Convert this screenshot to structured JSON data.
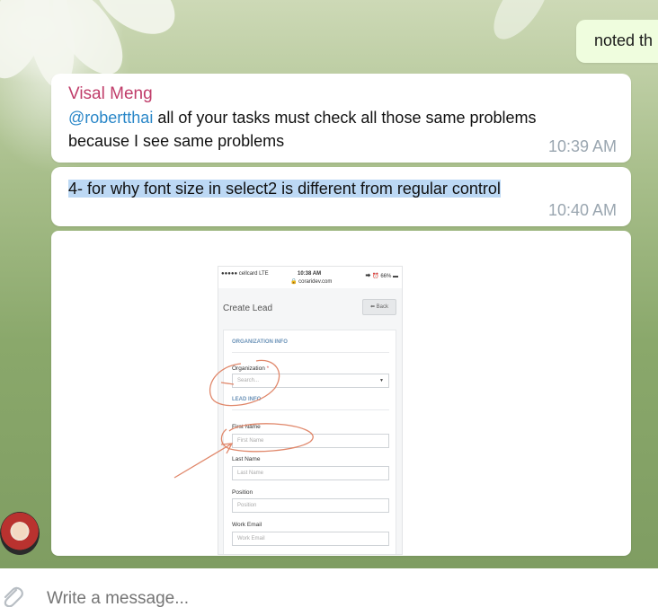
{
  "outgoing_message": {
    "text": "noted th"
  },
  "messages": [
    {
      "sender": "Visal Meng",
      "mention": "@robertthai",
      "line1_rest": " all of your tasks must check all those same problems",
      "line2": "because I see same problems",
      "time": "10:39 AM"
    },
    {
      "text": "4- for why font size in select2 is different from regular control",
      "time": "10:40 AM"
    }
  ],
  "attachment": {
    "status_carrier": "●●●●● cellcard  LTE",
    "status_time": "10:38 AM",
    "status_battery": "⮕ ⏰ 66% ▬",
    "status_url": "🔒 coraridev.com",
    "title": "Create Lead",
    "back_label": "⬅ Back",
    "section_org": "ORGANIZATION INFO",
    "org_label": "Organization",
    "org_required": "*",
    "org_placeholder": "Search...",
    "section_lead": "LEAD INFO",
    "first_name_label": "First Name",
    "first_name_placeholder": "First Name",
    "last_name_label": "Last Name",
    "last_name_placeholder": "Last Name",
    "position_label": "Position",
    "position_placeholder": "Position",
    "work_email_label": "Work Email",
    "work_email_placeholder": "Work Email"
  },
  "composer": {
    "placeholder": "Write a message..."
  },
  "colors": {
    "sender": "#c03d6a",
    "mention": "#2a87c8",
    "time": "#9aa6b0",
    "highlight": "#bcd8f4",
    "annotation": "#e0876a"
  }
}
